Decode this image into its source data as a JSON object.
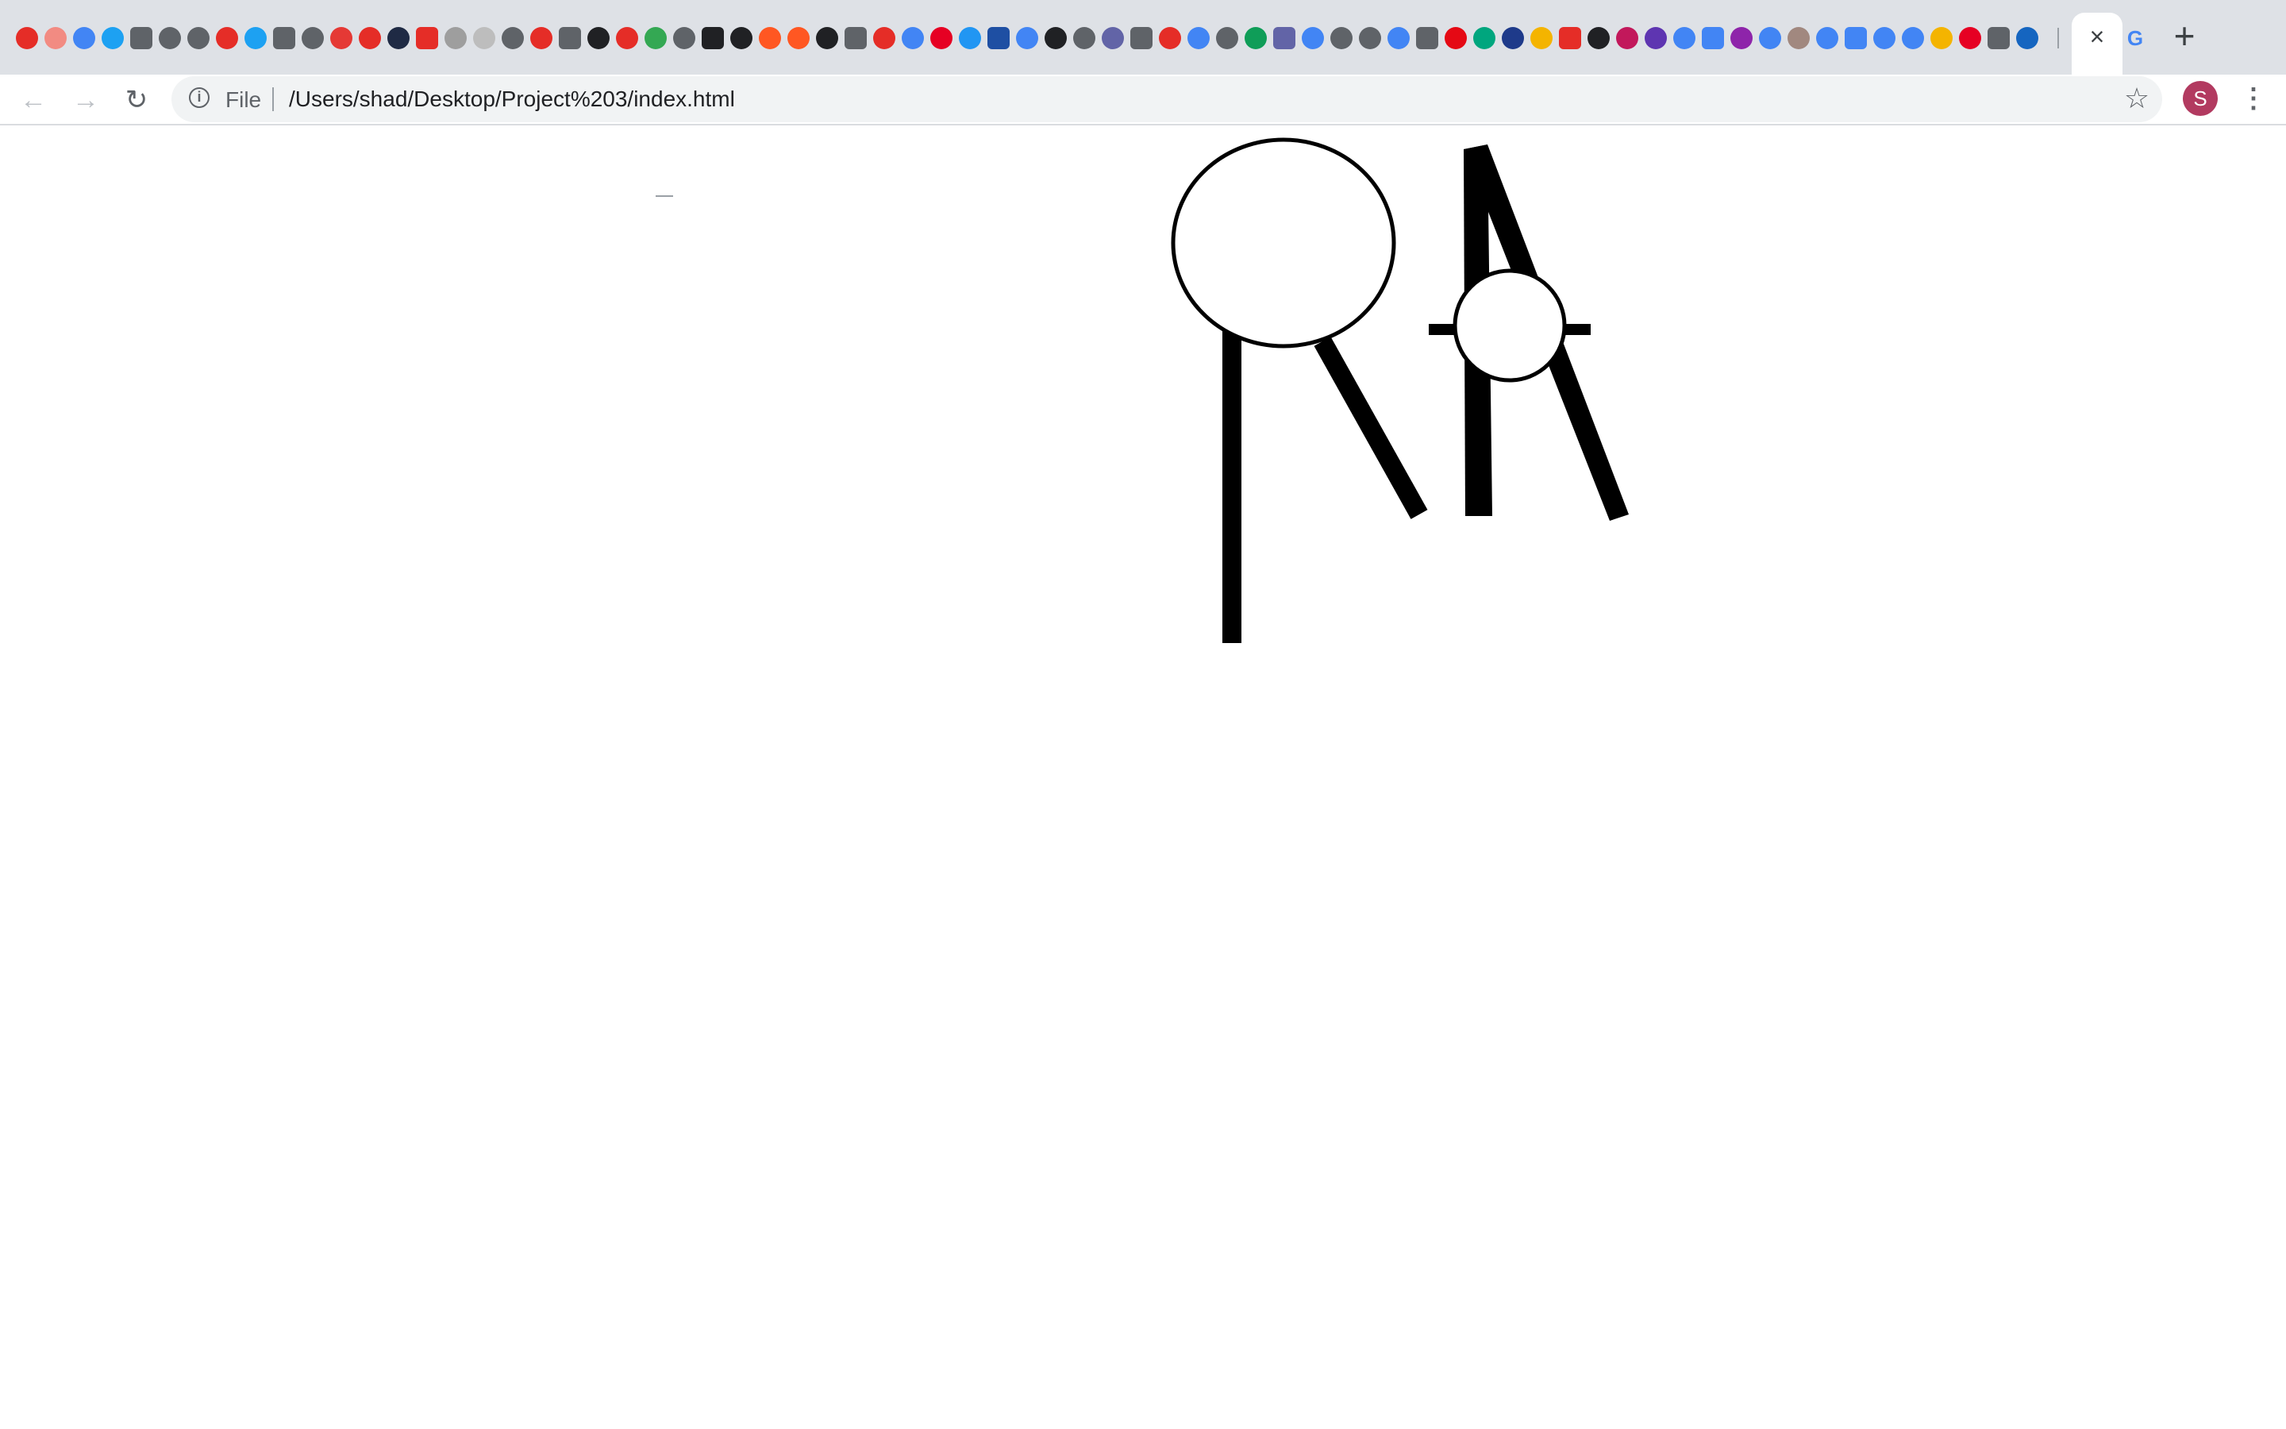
{
  "browser": {
    "tab_favicon_colors": [
      "#e52d27",
      "#f28b82",
      "#4285f4",
      "#1da1f2",
      "#5f6368",
      "#5f6368",
      "#5f6368",
      "#e52d27",
      "#1da1f2",
      "#5f6368",
      "#5f6368",
      "#e53935",
      "#e52d27",
      "#1f2a44",
      "#e52d27",
      "#9e9e9e",
      "#bdbdbd",
      "#5f6368",
      "#e52d27",
      "#5f6368",
      "#202124",
      "#e52d27",
      "#34a853",
      "#5f6368",
      "#202124",
      "#202124",
      "#ff5722",
      "#ff5722",
      "#202124",
      "#5f6368",
      "#e52d27",
      "#4285f4",
      "#e60023",
      "#2196f3",
      "#1e4fa3",
      "#4285f4",
      "#202124",
      "#5f6368",
      "#6264a7",
      "#5f6368",
      "#e52d27",
      "#4285f4",
      "#5f6368",
      "#0f9d58",
      "#6264a7",
      "#4285f4",
      "#5f6368",
      "#5f6368",
      "#4285f4",
      "#5f6368",
      "#e50914",
      "#00a67e",
      "#1e3a8a",
      "#f4b400",
      "#e52d27",
      "#202124",
      "#c2185b",
      "#5e35b1",
      "#4285f4",
      "#4285f4",
      "#8e24aa",
      "#4285f4",
      "#a1887f",
      "#4285f4",
      "#4285f4",
      "#4285f4",
      "#4285f4",
      "#f4b400",
      "#e60023",
      "#5f6368",
      "#1565c0"
    ],
    "active_tab_close": "×",
    "new_tab": "+",
    "back_icon": "back-arrow-icon",
    "forward_icon": "forward-arrow-icon",
    "reload_icon": "reload-icon",
    "back_glyph": "←",
    "forward_glyph": "→",
    "reload_glyph": "↻",
    "info_glyph": "i",
    "file_label": "File",
    "url": "/Users/shad/Desktop/Project%203/index.html",
    "star_glyph": "☆",
    "avatar_letter": "S",
    "avatar_color": "#b23a60",
    "menu_glyph": "⋮"
  },
  "page": {
    "stroke_color": "#000000",
    "background": "#ffffff"
  }
}
